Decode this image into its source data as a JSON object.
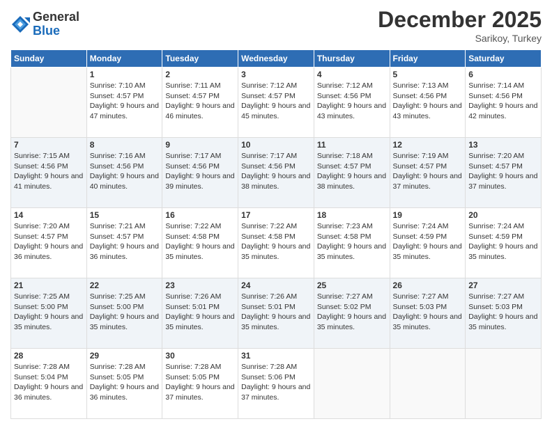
{
  "header": {
    "logo": {
      "general": "General",
      "blue": "Blue"
    },
    "title": "December 2025",
    "location": "Sarikoy, Turkey"
  },
  "calendar": {
    "days_of_week": [
      "Sunday",
      "Monday",
      "Tuesday",
      "Wednesday",
      "Thursday",
      "Friday",
      "Saturday"
    ],
    "weeks": [
      [
        {
          "day": "",
          "sunrise": "",
          "sunset": "",
          "daylight": ""
        },
        {
          "day": "1",
          "sunrise": "Sunrise: 7:10 AM",
          "sunset": "Sunset: 4:57 PM",
          "daylight": "Daylight: 9 hours and 47 minutes."
        },
        {
          "day": "2",
          "sunrise": "Sunrise: 7:11 AM",
          "sunset": "Sunset: 4:57 PM",
          "daylight": "Daylight: 9 hours and 46 minutes."
        },
        {
          "day": "3",
          "sunrise": "Sunrise: 7:12 AM",
          "sunset": "Sunset: 4:57 PM",
          "daylight": "Daylight: 9 hours and 45 minutes."
        },
        {
          "day": "4",
          "sunrise": "Sunrise: 7:12 AM",
          "sunset": "Sunset: 4:56 PM",
          "daylight": "Daylight: 9 hours and 43 minutes."
        },
        {
          "day": "5",
          "sunrise": "Sunrise: 7:13 AM",
          "sunset": "Sunset: 4:56 PM",
          "daylight": "Daylight: 9 hours and 43 minutes."
        },
        {
          "day": "6",
          "sunrise": "Sunrise: 7:14 AM",
          "sunset": "Sunset: 4:56 PM",
          "daylight": "Daylight: 9 hours and 42 minutes."
        }
      ],
      [
        {
          "day": "7",
          "sunrise": "Sunrise: 7:15 AM",
          "sunset": "Sunset: 4:56 PM",
          "daylight": "Daylight: 9 hours and 41 minutes."
        },
        {
          "day": "8",
          "sunrise": "Sunrise: 7:16 AM",
          "sunset": "Sunset: 4:56 PM",
          "daylight": "Daylight: 9 hours and 40 minutes."
        },
        {
          "day": "9",
          "sunrise": "Sunrise: 7:17 AM",
          "sunset": "Sunset: 4:56 PM",
          "daylight": "Daylight: 9 hours and 39 minutes."
        },
        {
          "day": "10",
          "sunrise": "Sunrise: 7:17 AM",
          "sunset": "Sunset: 4:56 PM",
          "daylight": "Daylight: 9 hours and 38 minutes."
        },
        {
          "day": "11",
          "sunrise": "Sunrise: 7:18 AM",
          "sunset": "Sunset: 4:57 PM",
          "daylight": "Daylight: 9 hours and 38 minutes."
        },
        {
          "day": "12",
          "sunrise": "Sunrise: 7:19 AM",
          "sunset": "Sunset: 4:57 PM",
          "daylight": "Daylight: 9 hours and 37 minutes."
        },
        {
          "day": "13",
          "sunrise": "Sunrise: 7:20 AM",
          "sunset": "Sunset: 4:57 PM",
          "daylight": "Daylight: 9 hours and 37 minutes."
        }
      ],
      [
        {
          "day": "14",
          "sunrise": "Sunrise: 7:20 AM",
          "sunset": "Sunset: 4:57 PM",
          "daylight": "Daylight: 9 hours and 36 minutes."
        },
        {
          "day": "15",
          "sunrise": "Sunrise: 7:21 AM",
          "sunset": "Sunset: 4:57 PM",
          "daylight": "Daylight: 9 hours and 36 minutes."
        },
        {
          "day": "16",
          "sunrise": "Sunrise: 7:22 AM",
          "sunset": "Sunset: 4:58 PM",
          "daylight": "Daylight: 9 hours and 35 minutes."
        },
        {
          "day": "17",
          "sunrise": "Sunrise: 7:22 AM",
          "sunset": "Sunset: 4:58 PM",
          "daylight": "Daylight: 9 hours and 35 minutes."
        },
        {
          "day": "18",
          "sunrise": "Sunrise: 7:23 AM",
          "sunset": "Sunset: 4:58 PM",
          "daylight": "Daylight: 9 hours and 35 minutes."
        },
        {
          "day": "19",
          "sunrise": "Sunrise: 7:24 AM",
          "sunset": "Sunset: 4:59 PM",
          "daylight": "Daylight: 9 hours and 35 minutes."
        },
        {
          "day": "20",
          "sunrise": "Sunrise: 7:24 AM",
          "sunset": "Sunset: 4:59 PM",
          "daylight": "Daylight: 9 hours and 35 minutes."
        }
      ],
      [
        {
          "day": "21",
          "sunrise": "Sunrise: 7:25 AM",
          "sunset": "Sunset: 5:00 PM",
          "daylight": "Daylight: 9 hours and 35 minutes."
        },
        {
          "day": "22",
          "sunrise": "Sunrise: 7:25 AM",
          "sunset": "Sunset: 5:00 PM",
          "daylight": "Daylight: 9 hours and 35 minutes."
        },
        {
          "day": "23",
          "sunrise": "Sunrise: 7:26 AM",
          "sunset": "Sunset: 5:01 PM",
          "daylight": "Daylight: 9 hours and 35 minutes."
        },
        {
          "day": "24",
          "sunrise": "Sunrise: 7:26 AM",
          "sunset": "Sunset: 5:01 PM",
          "daylight": "Daylight: 9 hours and 35 minutes."
        },
        {
          "day": "25",
          "sunrise": "Sunrise: 7:27 AM",
          "sunset": "Sunset: 5:02 PM",
          "daylight": "Daylight: 9 hours and 35 minutes."
        },
        {
          "day": "26",
          "sunrise": "Sunrise: 7:27 AM",
          "sunset": "Sunset: 5:03 PM",
          "daylight": "Daylight: 9 hours and 35 minutes."
        },
        {
          "day": "27",
          "sunrise": "Sunrise: 7:27 AM",
          "sunset": "Sunset: 5:03 PM",
          "daylight": "Daylight: 9 hours and 35 minutes."
        }
      ],
      [
        {
          "day": "28",
          "sunrise": "Sunrise: 7:28 AM",
          "sunset": "Sunset: 5:04 PM",
          "daylight": "Daylight: 9 hours and 36 minutes."
        },
        {
          "day": "29",
          "sunrise": "Sunrise: 7:28 AM",
          "sunset": "Sunset: 5:05 PM",
          "daylight": "Daylight: 9 hours and 36 minutes."
        },
        {
          "day": "30",
          "sunrise": "Sunrise: 7:28 AM",
          "sunset": "Sunset: 5:05 PM",
          "daylight": "Daylight: 9 hours and 37 minutes."
        },
        {
          "day": "31",
          "sunrise": "Sunrise: 7:28 AM",
          "sunset": "Sunset: 5:06 PM",
          "daylight": "Daylight: 9 hours and 37 minutes."
        },
        {
          "day": "",
          "sunrise": "",
          "sunset": "",
          "daylight": ""
        },
        {
          "day": "",
          "sunrise": "",
          "sunset": "",
          "daylight": ""
        },
        {
          "day": "",
          "sunrise": "",
          "sunset": "",
          "daylight": ""
        }
      ]
    ]
  }
}
